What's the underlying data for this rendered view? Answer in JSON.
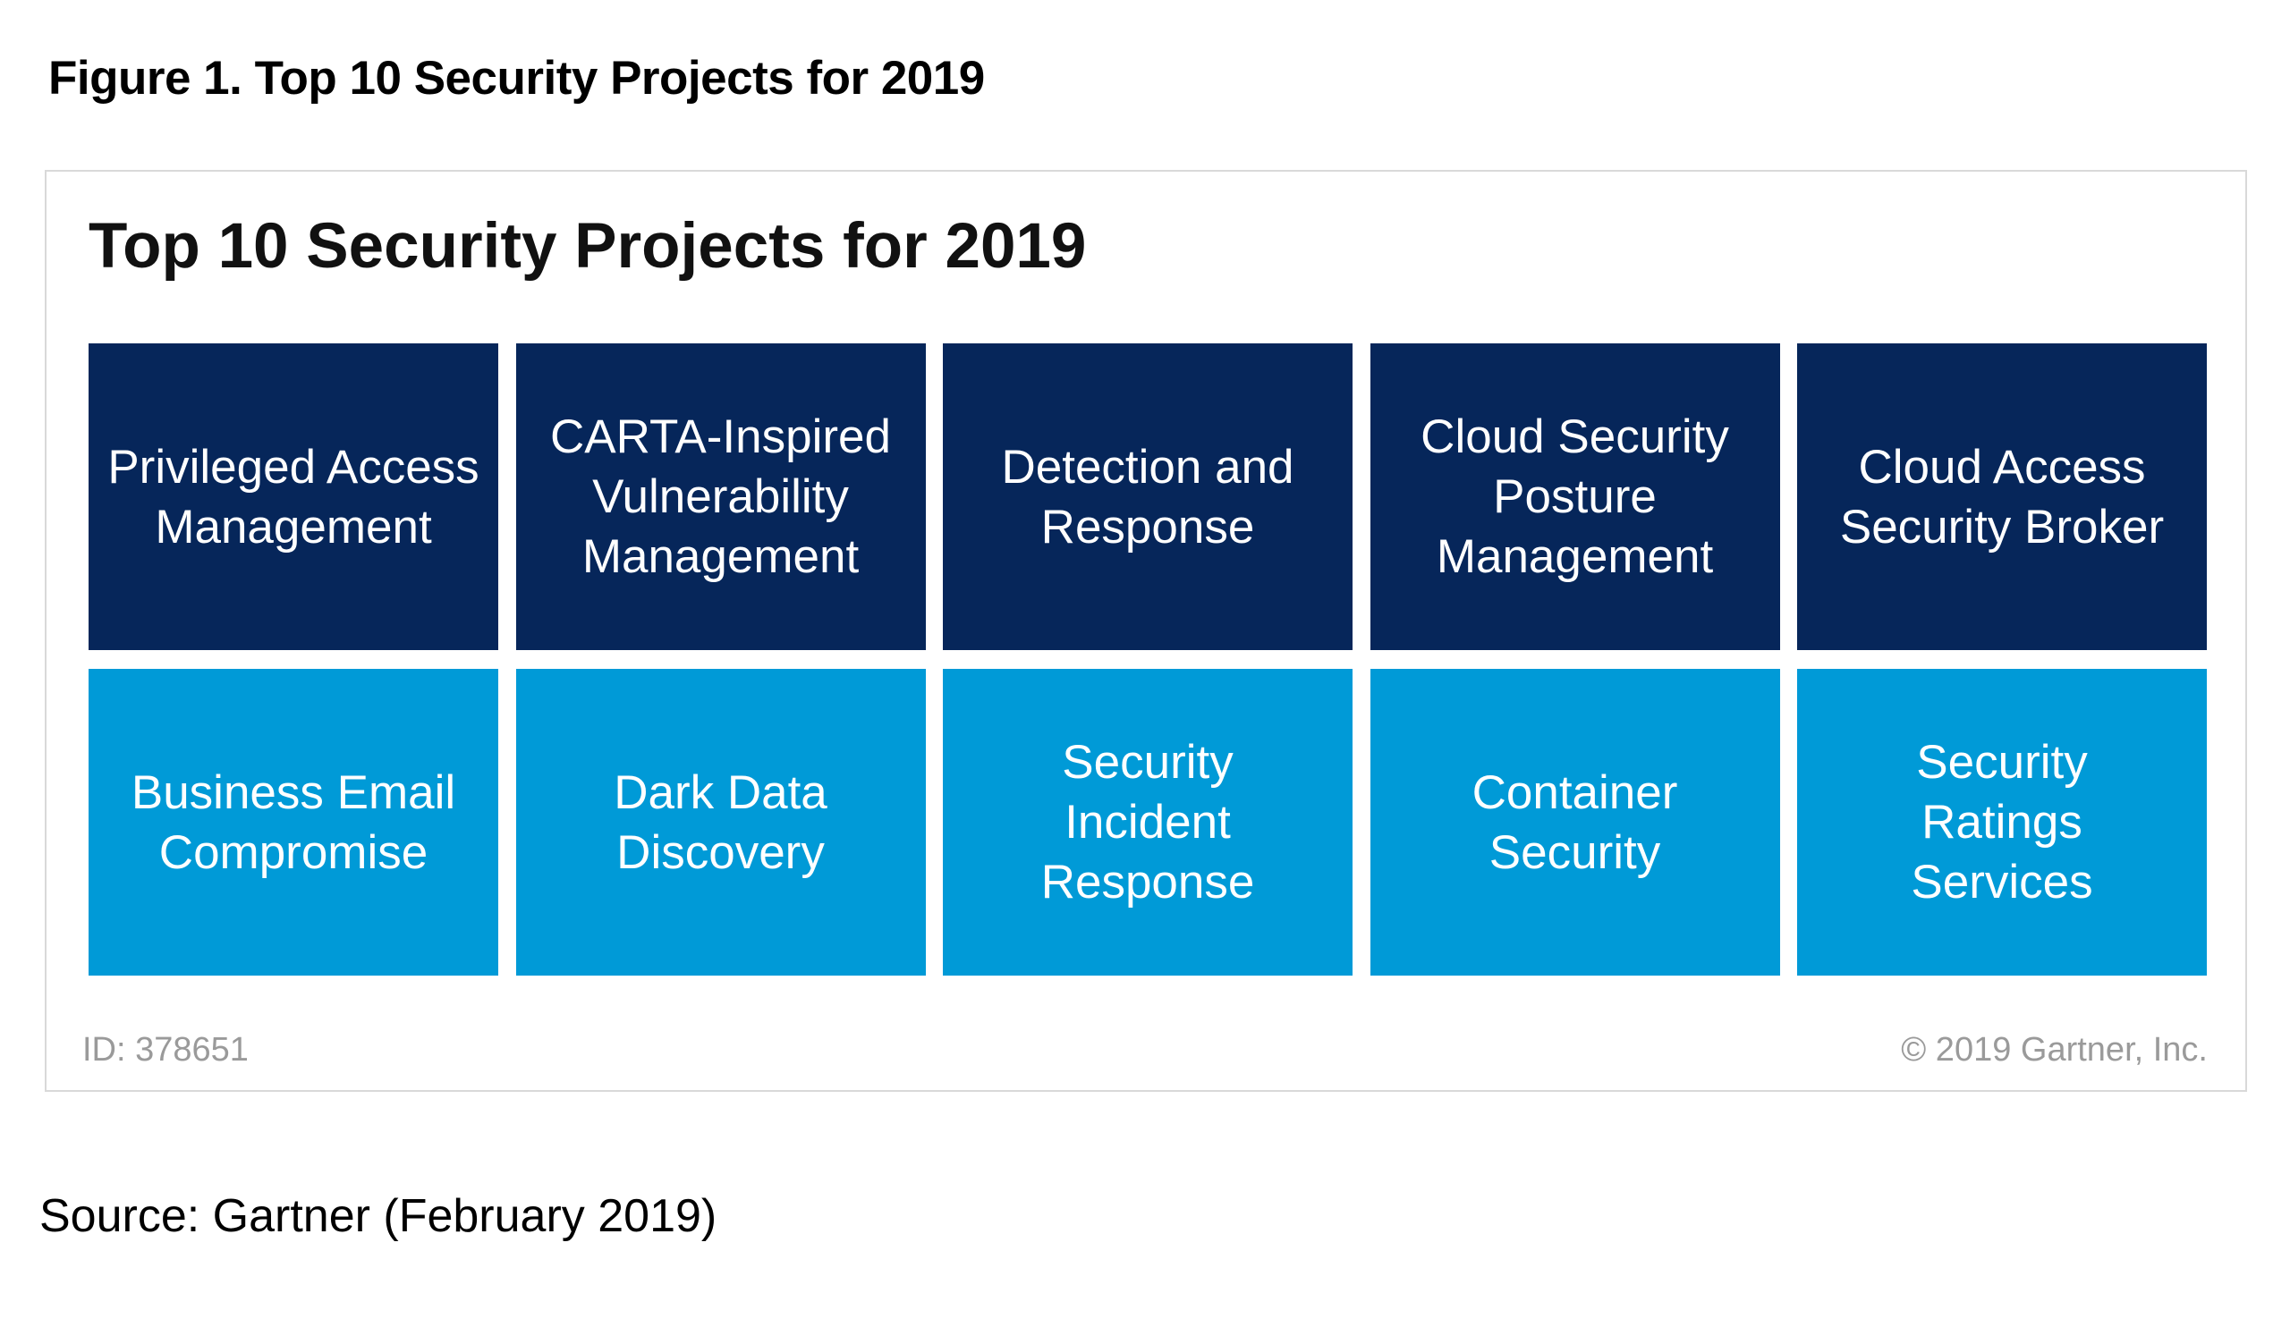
{
  "caption": "Figure 1. Top 10 Security Projects for 2019",
  "figure": {
    "title": "Top 10 Security Projects for 2019",
    "colors": {
      "top_row": "#06265a",
      "bottom_row": "#009ad7",
      "tile_text": "#ffffff",
      "footer_text": "#9a9a9a",
      "border": "#d9d9d9"
    },
    "rows": [
      {
        "tiles": [
          {
            "label": "Privileged Access Management"
          },
          {
            "label": "CARTA-Inspired Vulnerability Management"
          },
          {
            "label": "Detection and Response"
          },
          {
            "label": "Cloud Security Posture Management"
          },
          {
            "label": "Cloud Access Security Broker"
          }
        ]
      },
      {
        "tiles": [
          {
            "label": "Business Email Compromise"
          },
          {
            "label": "Dark Data Discovery"
          },
          {
            "label": "Security Incident Response"
          },
          {
            "label": "Container Security"
          },
          {
            "label": "Security Ratings Services"
          }
        ]
      }
    ],
    "footer": {
      "id": "ID: 378651",
      "copyright": "© 2019 Gartner, Inc."
    }
  },
  "source": "Source: Gartner (February 2019)"
}
